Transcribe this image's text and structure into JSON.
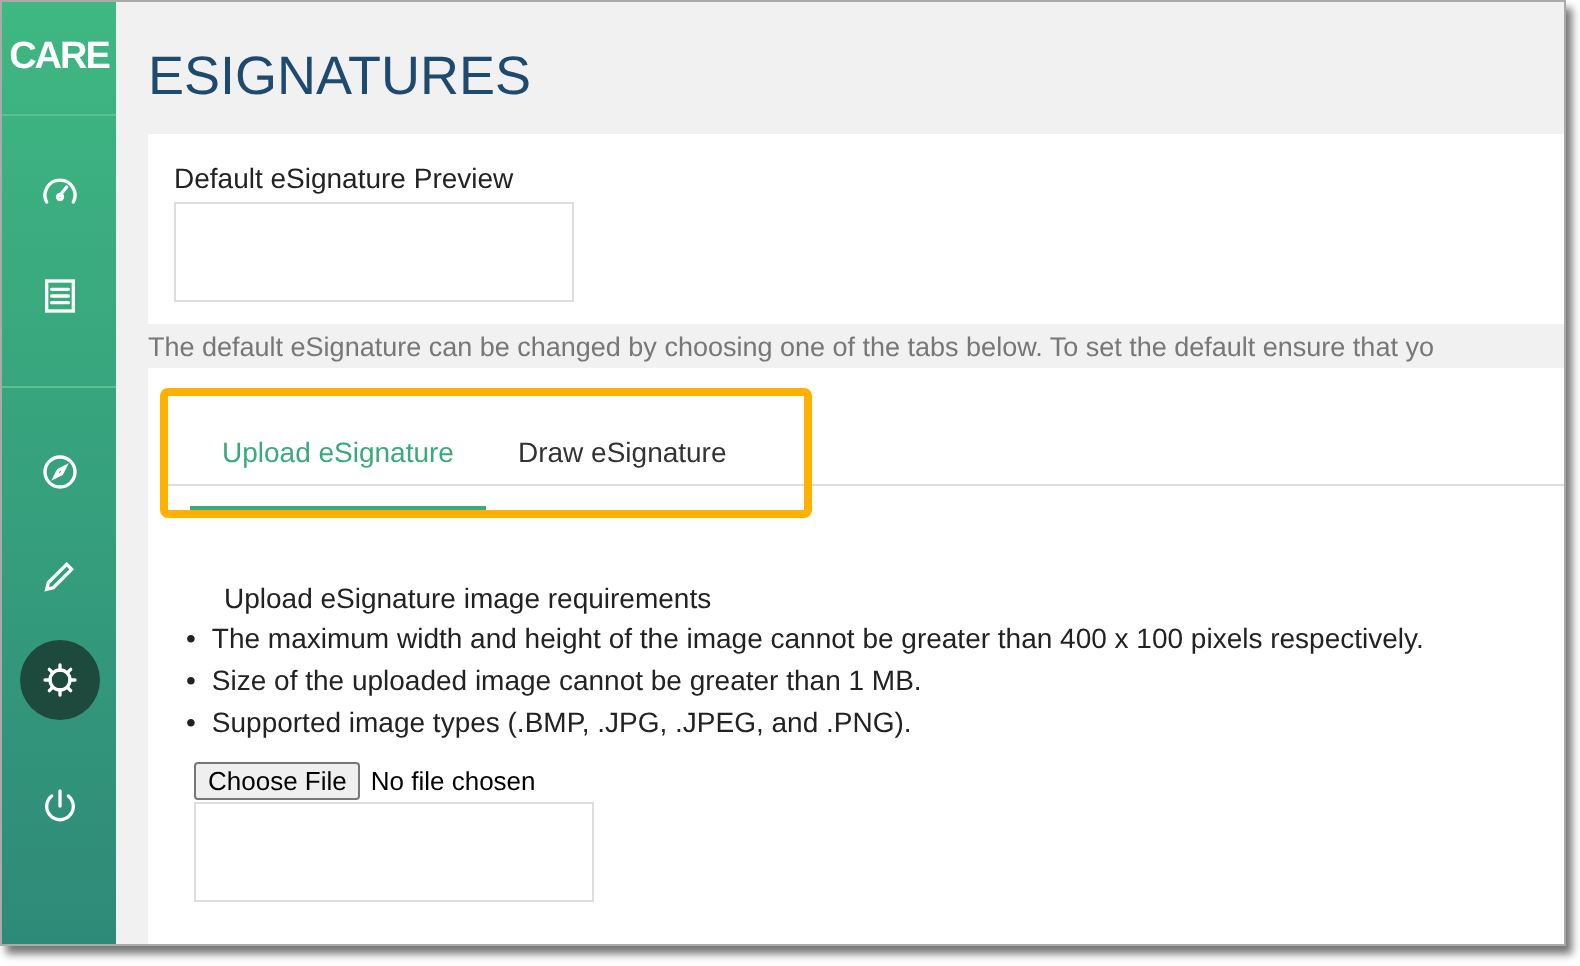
{
  "logo": "CARE",
  "sidebar": {
    "items": [
      {
        "selected": false
      },
      {
        "selected": false
      },
      {
        "selected": false
      },
      {
        "selected": false
      },
      {
        "selected": true
      },
      {
        "selected": false
      }
    ]
  },
  "title": "ESIGNATURES",
  "preview": {
    "label": "Default eSignature Preview"
  },
  "notice": "The default eSignature can be changed by choosing one of the tabs below. To set the default ensure that yo",
  "tabs": [
    {
      "label": "Upload eSignature",
      "selected": true
    },
    {
      "label": "Draw eSignature",
      "selected": false
    }
  ],
  "requirements": {
    "heading": "Upload eSignature image requirements",
    "items": [
      {
        "marker": "•",
        "text": "The maximum width and height of the image cannot be greater than 400 x 100 pixels respectively."
      },
      {
        "marker": "•",
        "text": "Size of the uploaded image cannot be greater than 1 MB."
      },
      {
        "marker": "•",
        "text": "Supported image types (.BMP, .JPG, .JPEG, and .PNG)."
      }
    ]
  },
  "file": {
    "button": "Choose File",
    "status": "No file chosen"
  }
}
